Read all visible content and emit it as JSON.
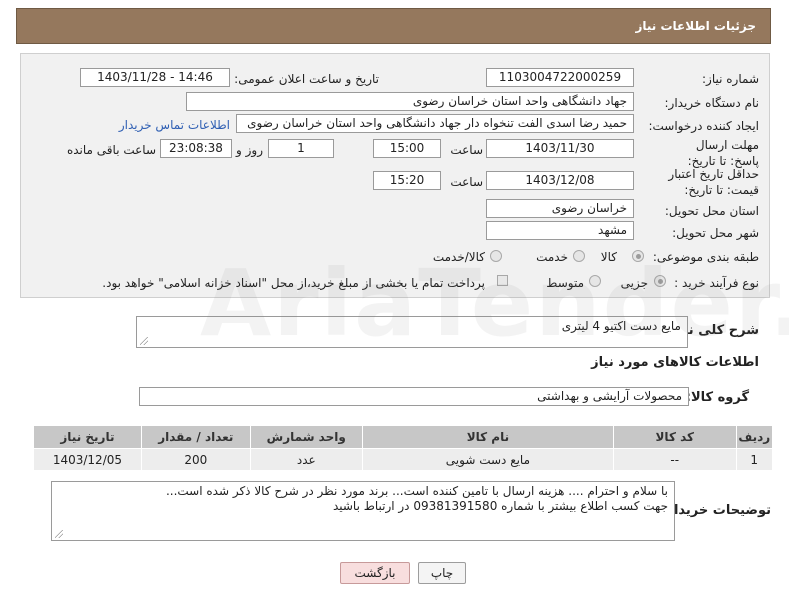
{
  "header": {
    "title": "جزئیات اطلاعات نیاز"
  },
  "form": {
    "need_number_label": "شماره نیاز:",
    "need_number": "1103004722000259",
    "announce_label": "تاریخ و ساعت اعلان عمومی:",
    "announce_value": "1403/11/28 - 14:46",
    "buyer_org_label": "نام دستگاه خریدار:",
    "buyer_org": "جهاد دانشگاهی واحد استان خراسان رضوی",
    "creator_label": "ایجاد کننده درخواست:",
    "creator": "حمید رضا اسدی الفت تنخواه دار جهاد دانشگاهی واحد استان خراسان رضوی",
    "contact_link": "اطلاعات تماس خریدار",
    "deadline_label": "مهلت ارسال پاسخ: تا تاریخ:",
    "deadline_date": "1403/11/30",
    "time_label": "ساعت",
    "deadline_time": "15:00",
    "days_value": "1",
    "days_label": "روز و",
    "remaining_value": "23:08:38",
    "remaining_label": "ساعت باقی مانده",
    "min_price_label": "حداقل تاریخ اعتبار قیمت: تا تاریخ:",
    "min_price_date": "1403/12/08",
    "min_price_time": "15:20",
    "province_label": "استان محل تحویل:",
    "province": "خراسان رضوی",
    "city_label": "شهر محل تحویل:",
    "city": "مشهد",
    "category_label": "طبقه بندی موضوعی:",
    "category_options": [
      "کالا",
      "خدمت",
      "کالا/خدمت"
    ],
    "category_selected": "کالا",
    "process_label": "نوع فرآیند خرید :",
    "process_options": [
      "جزیی",
      "متوسط"
    ],
    "process_selected": "جزیی",
    "payment_note": "پرداخت تمام یا بخشی از مبلغ خرید،از محل \"اسناد خزانه اسلامی\" خواهد بود."
  },
  "summary": {
    "label": "شرح کلی نیاز:",
    "value": "مایع دست اکتیو 4 لیتری"
  },
  "goods_info": {
    "title": "اطلاعات کالاهای مورد نیاز",
    "group_label": "گروه کالا:",
    "group_value": "محصولات آرایشی و بهداشتی"
  },
  "table": {
    "headers": [
      "ردیف",
      "کد کالا",
      "نام کالا",
      "واحد شمارش",
      "تعداد / مقدار",
      "تاریخ نیاز"
    ],
    "rows": [
      [
        "1",
        "--",
        "مایع دست شویی",
        "عدد",
        "200",
        "1403/12/05"
      ]
    ]
  },
  "buyer_notes": {
    "label": "توضیحات خریدار:",
    "line1": "با سلام و احترام .... هزینه ارسال با تامین کننده است... برند مورد نظر در شرح کالا ذکر شده است...",
    "line2": "جهت کسب اطلاع بیشتر با شماره 09381391580 در ارتباط باشید"
  },
  "buttons": {
    "print": "چاپ",
    "back": "بازگشت"
  },
  "watermark": "AriaTender.neT"
}
